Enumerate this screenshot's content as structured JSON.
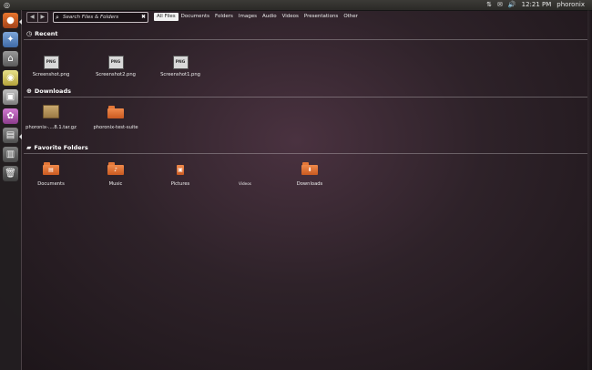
{
  "top_panel": {
    "logo_glyph": "◎",
    "indicators": [
      "⇅",
      "✉",
      "🔊",
      "🕒"
    ],
    "time": "12:21 PM",
    "user": "phoronix"
  },
  "launcher": {
    "icons": [
      "firefox-icon",
      "chat-icon",
      "files-icon",
      "rhythmbox-icon",
      "software-center-icon",
      "workspaces-icon",
      "apps-icon",
      "trash-icon"
    ]
  },
  "dash": {
    "search_placeholder": "Search Files & Folders",
    "filters": [
      "All Files",
      "Documents",
      "Folders",
      "Images",
      "Audio",
      "Videos",
      "Presentations",
      "Other"
    ],
    "active_filter": "All Files",
    "sections": {
      "recent": {
        "title": "Recent",
        "items": [
          {
            "label": "Screenshot.png",
            "badge": "PNG"
          },
          {
            "label": "Screenshot2.png",
            "badge": "PNG"
          },
          {
            "label": "Screenshot1.png",
            "badge": "PNG"
          }
        ]
      },
      "downloads": {
        "title": "Downloads",
        "items": [
          {
            "label": "phoronix-....8.1.tar.gz"
          },
          {
            "label": "phoronix-test-suite"
          }
        ]
      },
      "favorites": {
        "title": "Favorite Folders",
        "items": [
          {
            "label": "Documents"
          },
          {
            "label": "Music"
          },
          {
            "label": "Pictures"
          },
          {
            "label": "Videos"
          },
          {
            "label": "Downloads"
          }
        ]
      }
    }
  }
}
